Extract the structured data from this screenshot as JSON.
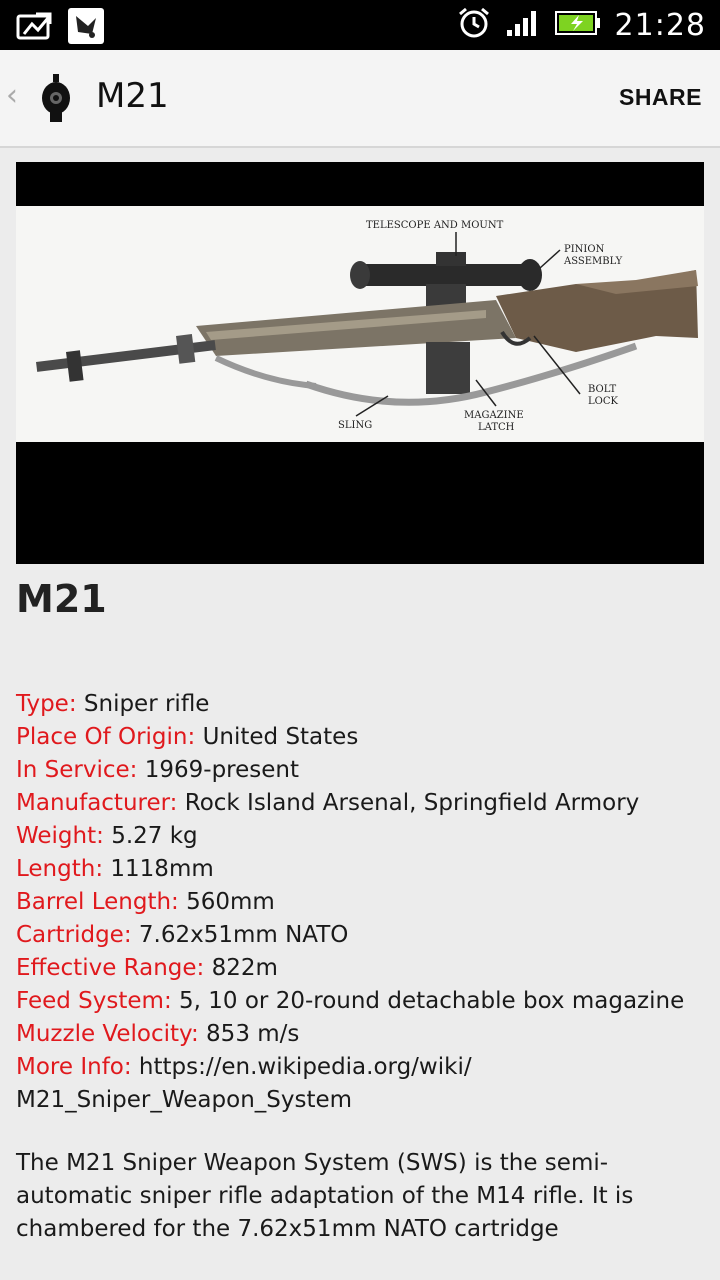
{
  "status_bar": {
    "time": "21:28",
    "icons": [
      "image-notification-icon",
      "feather-app-icon",
      "alarm-icon",
      "signal-icon",
      "battery-charging-icon"
    ]
  },
  "action_bar": {
    "back_glyph": "‹",
    "app_icon": "gun-muzzle-icon",
    "title": "M21",
    "share_label": "SHARE"
  },
  "hero_image": {
    "labels": {
      "telescope": "TELESCOPE AND MOUNT",
      "pinion_1": "PINION",
      "pinion_2": "ASSEMBLY",
      "bolt_1": "BOLT",
      "bolt_2": "LOCK",
      "sling": "SLING",
      "magazine_1": "MAGAZINE",
      "magazine_2": "LATCH"
    }
  },
  "weapon": {
    "name": "M21",
    "specs": [
      {
        "key": "Type:",
        "value": "Sniper rifle"
      },
      {
        "key": "Place Of Origin:",
        "value": "United States"
      },
      {
        "key": "In Service:",
        "value": "1969-present"
      },
      {
        "key": "Manufacturer:",
        "value": "Rock Island Arsenal, Springfield Armory"
      },
      {
        "key": "Weight:",
        "value": "5.27 kg"
      },
      {
        "key": "Length:",
        "value": "1118mm"
      },
      {
        "key": "Barrel Length:",
        "value": "560mm"
      },
      {
        "key": "Cartridge:",
        "value": "7.62x51mm NATO"
      },
      {
        "key": "Effective Range:",
        "value": "822m"
      },
      {
        "key": "Feed System:",
        "value": "5, 10 or 20-round detachable box magazine"
      },
      {
        "key": "Muzzle Velocity:",
        "value": "853 m/s"
      },
      {
        "key": "More Info:",
        "value": "https://en.wikipedia.org/wiki/ M21_Sniper_Weapon_System"
      }
    ],
    "description": "The M21 Sniper Weapon System (SWS) is the semi-automatic sniper rifle adaptation of the M14 rifle. It is chambered for the 7.62x51mm NATO cartridge"
  },
  "colors": {
    "spec_key": "#e0191d",
    "background": "#ececec",
    "status_bar": "#000000",
    "battery": "#7ed321"
  }
}
